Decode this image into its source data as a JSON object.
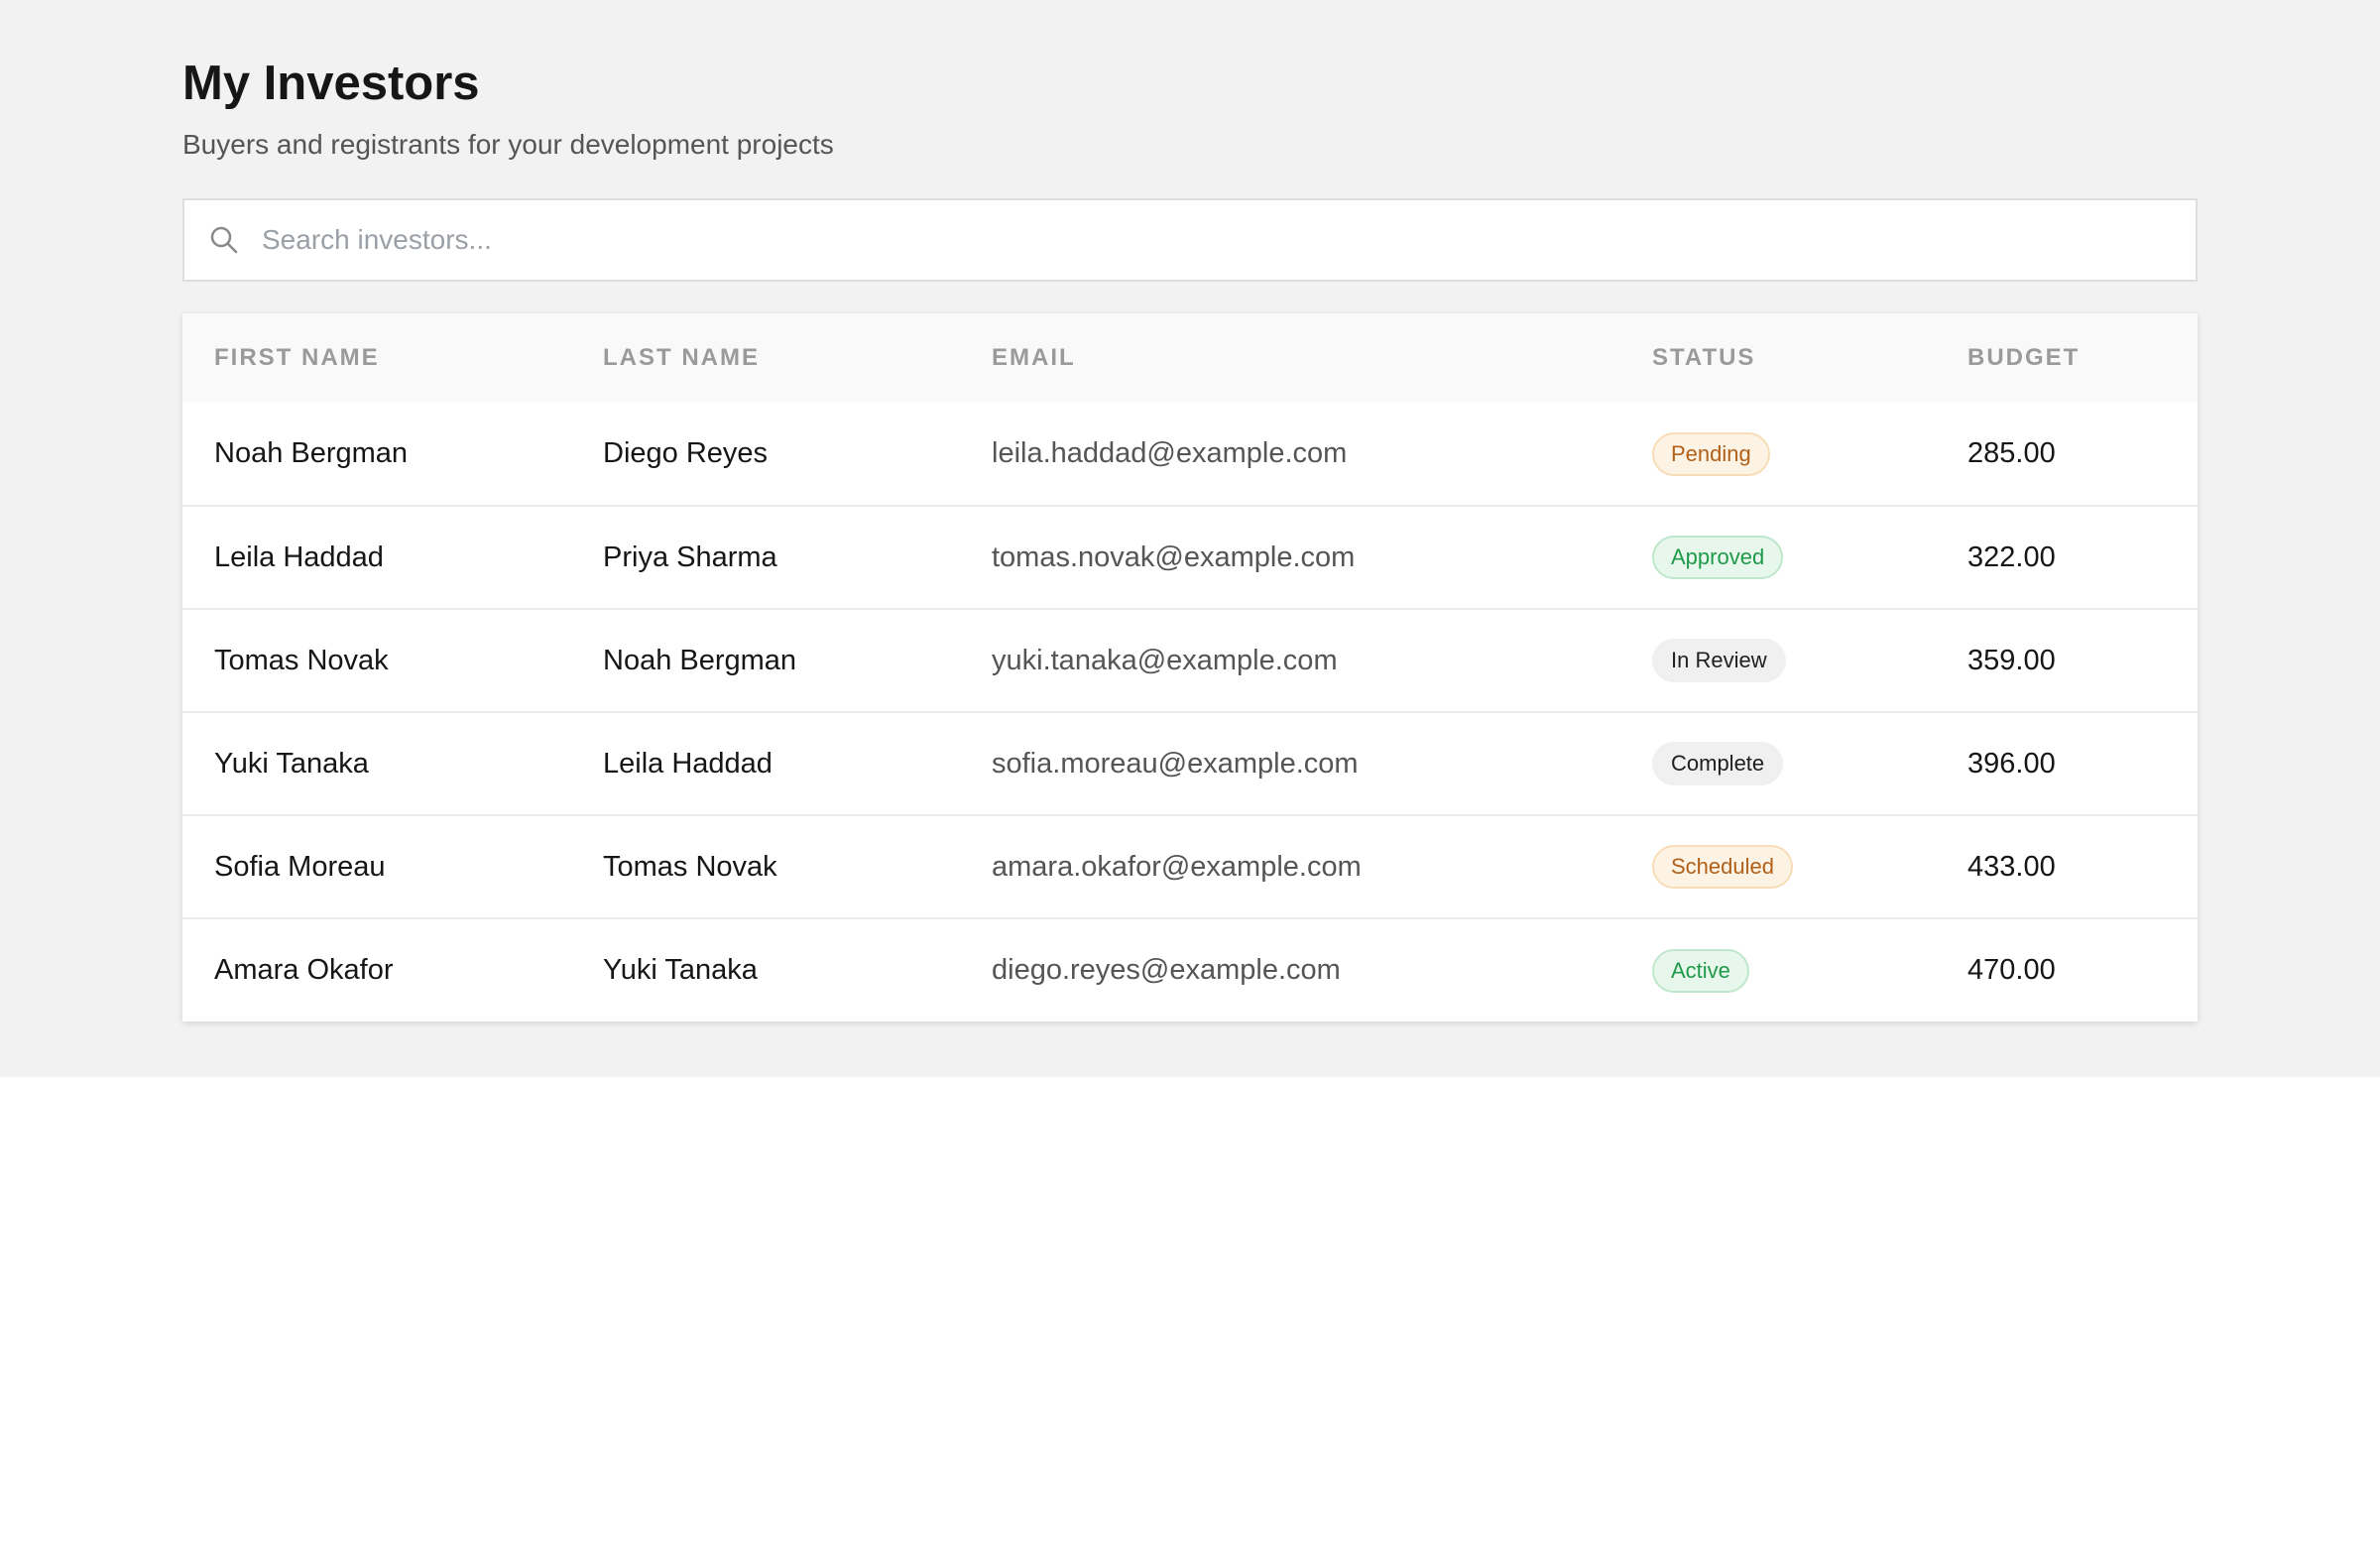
{
  "header": {
    "title": "My Investors",
    "subtitle": "Buyers and registrants for your development projects"
  },
  "search": {
    "placeholder": "Search investors...",
    "value": "",
    "icon": "search-icon"
  },
  "table": {
    "columns": {
      "first_name": "FIRST NAME",
      "last_name": "LAST NAME",
      "email": "EMAIL",
      "status": "STATUS",
      "budget": "BUDGET"
    },
    "rows": [
      {
        "first_name": "Noah Bergman",
        "last_name": "Diego Reyes",
        "email": "leila.haddad@example.com",
        "status": "Pending",
        "budget": "285.00"
      },
      {
        "first_name": "Leila Haddad",
        "last_name": "Priya Sharma",
        "email": "tomas.novak@example.com",
        "status": "Approved",
        "budget": "322.00"
      },
      {
        "first_name": "Tomas Novak",
        "last_name": "Noah Bergman",
        "email": "yuki.tanaka@example.com",
        "status": "In Review",
        "budget": "359.00"
      },
      {
        "first_name": "Yuki Tanaka",
        "last_name": "Leila Haddad",
        "email": "sofia.moreau@example.com",
        "status": "Complete",
        "budget": "396.00"
      },
      {
        "first_name": "Sofia Moreau",
        "last_name": "Tomas Novak",
        "email": "amara.okafor@example.com",
        "status": "Scheduled",
        "budget": "433.00"
      },
      {
        "first_name": "Amara Okafor",
        "last_name": "Yuki Tanaka",
        "email": "diego.reyes@example.com",
        "status": "Active",
        "budget": "470.00"
      }
    ]
  },
  "colors": {
    "page_background": "#f2f2f2",
    "pending": "#b1601a",
    "approved": "#1f9a4a",
    "neutral_badge": "#f0f0f0"
  }
}
